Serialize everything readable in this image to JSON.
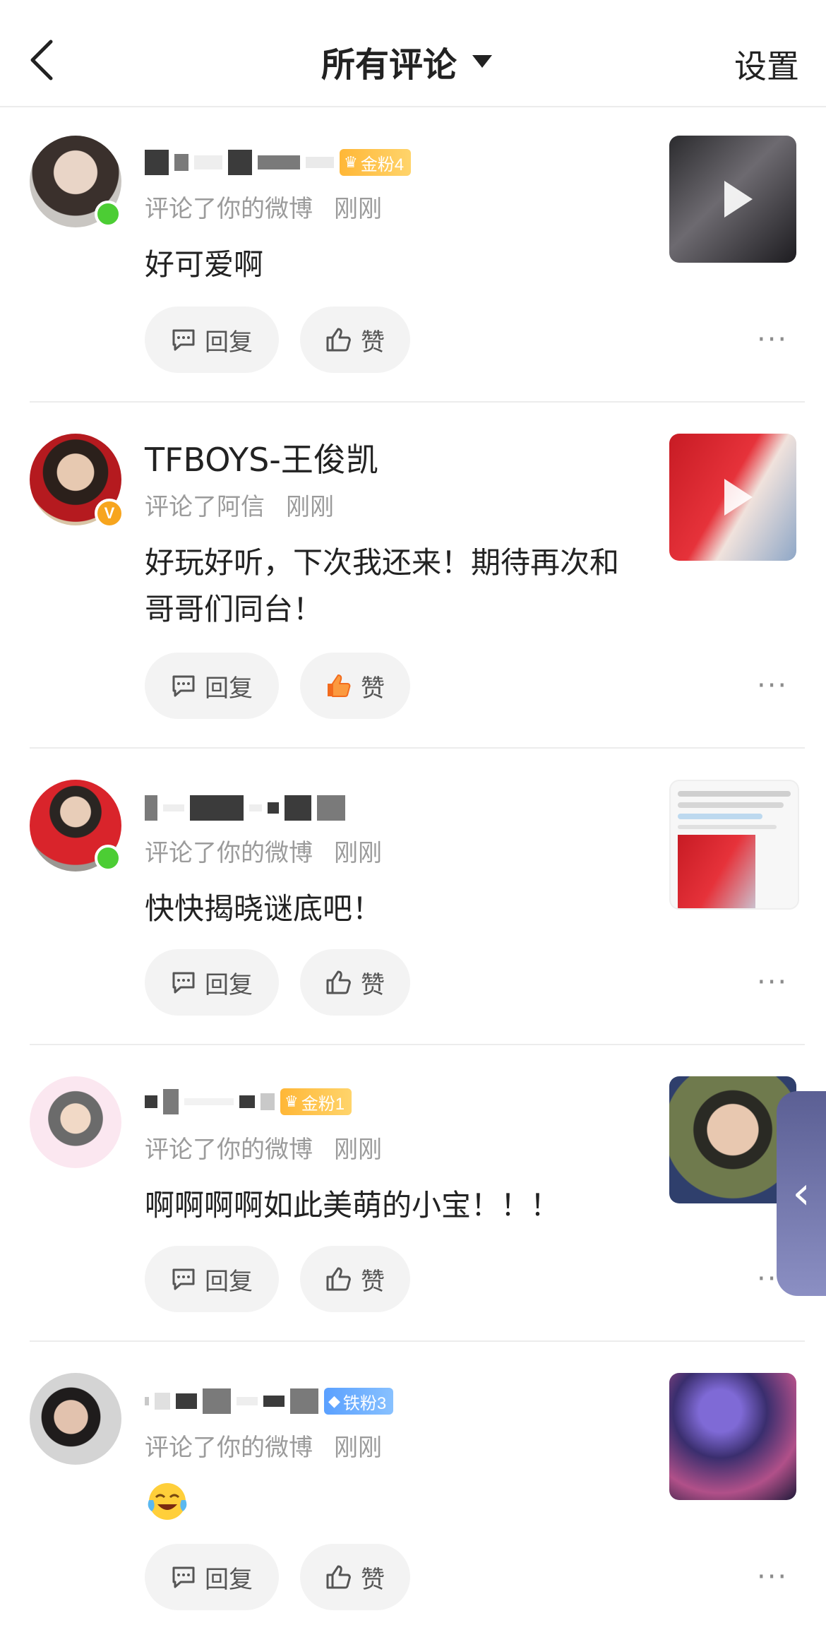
{
  "header": {
    "back_icon": "chevron-left-icon",
    "title": "所有评论",
    "settings": "设置"
  },
  "actions": {
    "reply": "回复",
    "like": "赞",
    "more": "···"
  },
  "comments": [
    {
      "name": "",
      "badge": "金粉4",
      "badge_type": "gold",
      "action_text": "评论了你的微博",
      "time": "刚刚",
      "content": "好可爱啊",
      "avatar_status": "online",
      "liked": false,
      "thumbnail": "video-thumbnail"
    },
    {
      "name": "TFBOYS-王俊凯",
      "badge": "",
      "action_text": "评论了阿信",
      "time": "刚刚",
      "content": "好玩好听，下次我还来！期待再次和哥哥们同台！",
      "avatar_status": "verified",
      "liked": true,
      "thumbnail": "video-thumbnail"
    },
    {
      "name": "",
      "badge": "",
      "action_text": "评论了你的微博",
      "time": "刚刚",
      "content": "快快揭晓谜底吧！",
      "avatar_status": "online",
      "liked": false,
      "thumbnail": "post-thumbnail"
    },
    {
      "name": "",
      "badge": "金粉1",
      "badge_type": "gold",
      "action_text": "评论了你的微博",
      "time": "刚刚",
      "content": "啊啊啊啊如此美萌的小宝！！！",
      "avatar_status": "none",
      "liked": false,
      "thumbnail": "image-thumbnail"
    },
    {
      "name": "",
      "badge": "铁粉3",
      "badge_type": "iron",
      "action_text": "评论了你的微博",
      "time": "刚刚",
      "content": "",
      "emoji": "crying-laughing-emoji",
      "avatar_status": "none",
      "liked": false,
      "thumbnail": "image-thumbnail"
    }
  ],
  "colors": {
    "online": "#4ccd34",
    "verified": "#f7a51e",
    "gold_badge": "#ffb737",
    "iron_badge": "#5aa0ff",
    "liked": "#f26b1d"
  }
}
